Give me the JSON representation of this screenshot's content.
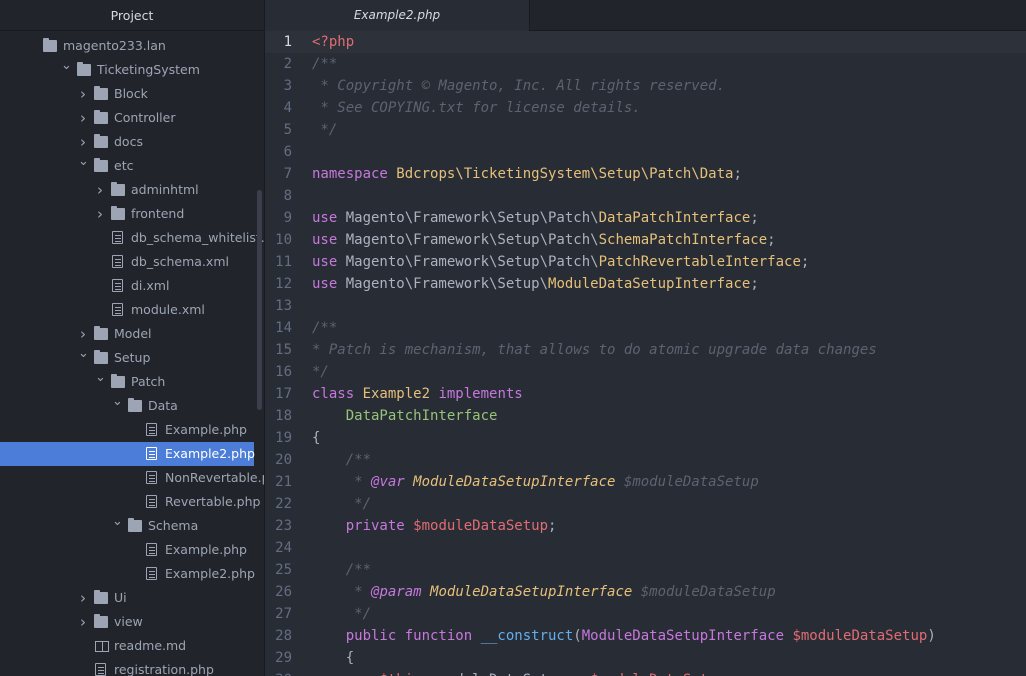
{
  "sidebar": {
    "header": "Project",
    "items": [
      {
        "label": "magento233.lan",
        "kind": "folder",
        "arrow": "",
        "indent": 0
      },
      {
        "label": "TicketingSystem",
        "kind": "folder",
        "arrow": "open",
        "indent": 2
      },
      {
        "label": "Block",
        "kind": "folder",
        "arrow": "closed",
        "indent": 3
      },
      {
        "label": "Controller",
        "kind": "folder",
        "arrow": "closed",
        "indent": 3
      },
      {
        "label": "docs",
        "kind": "folder",
        "arrow": "closed",
        "indent": 3
      },
      {
        "label": "etc",
        "kind": "folder",
        "arrow": "open",
        "indent": 3
      },
      {
        "label": "adminhtml",
        "kind": "folder",
        "arrow": "closed",
        "indent": 4
      },
      {
        "label": "frontend",
        "kind": "folder",
        "arrow": "closed",
        "indent": 4
      },
      {
        "label": "db_schema_whitelist.json",
        "kind": "file",
        "arrow": "",
        "indent": 4
      },
      {
        "label": "db_schema.xml",
        "kind": "file",
        "arrow": "",
        "indent": 4
      },
      {
        "label": "di.xml",
        "kind": "file",
        "arrow": "",
        "indent": 4
      },
      {
        "label": "module.xml",
        "kind": "file",
        "arrow": "",
        "indent": 4
      },
      {
        "label": "Model",
        "kind": "folder",
        "arrow": "closed",
        "indent": 3
      },
      {
        "label": "Setup",
        "kind": "folder",
        "arrow": "open",
        "indent": 3
      },
      {
        "label": "Patch",
        "kind": "folder",
        "arrow": "open",
        "indent": 4
      },
      {
        "label": "Data",
        "kind": "folder",
        "arrow": "open",
        "indent": 5
      },
      {
        "label": "Example.php",
        "kind": "file",
        "arrow": "",
        "indent": 6
      },
      {
        "label": "Example2.php",
        "kind": "file",
        "arrow": "",
        "indent": 6,
        "selected": true
      },
      {
        "label": "NonRevertable.php",
        "kind": "file",
        "arrow": "",
        "indent": 6
      },
      {
        "label": "Revertable.php",
        "kind": "file",
        "arrow": "",
        "indent": 6
      },
      {
        "label": "Schema",
        "kind": "folder",
        "arrow": "open",
        "indent": 5
      },
      {
        "label": "Example.php",
        "kind": "file",
        "arrow": "",
        "indent": 6
      },
      {
        "label": "Example2.php",
        "kind": "file",
        "arrow": "",
        "indent": 6
      },
      {
        "label": "Ui",
        "kind": "folder",
        "arrow": "closed",
        "indent": 3
      },
      {
        "label": "view",
        "kind": "folder",
        "arrow": "closed",
        "indent": 3
      },
      {
        "label": "readme.md",
        "kind": "book",
        "arrow": "",
        "indent": 3
      },
      {
        "label": "registration.php",
        "kind": "file",
        "arrow": "",
        "indent": 3
      }
    ]
  },
  "tabs": [
    {
      "label": "Example2.php",
      "active": true
    }
  ],
  "editor": {
    "current_line": 1,
    "lines": [
      {
        "n": "1",
        "tokens": [
          [
            "tag",
            "<?php"
          ]
        ]
      },
      {
        "n": "2",
        "tokens": [
          [
            "comment",
            "/**"
          ]
        ]
      },
      {
        "n": "3",
        "tokens": [
          [
            "comment",
            " * Copyright © Magento, Inc. All rights reserved."
          ]
        ]
      },
      {
        "n": "4",
        "tokens": [
          [
            "comment",
            " * See COPYING.txt for license details."
          ]
        ]
      },
      {
        "n": "5",
        "tokens": [
          [
            "comment",
            " */"
          ]
        ]
      },
      {
        "n": "6",
        "tokens": []
      },
      {
        "n": "7",
        "tokens": [
          [
            "kw",
            "namespace "
          ],
          [
            "class",
            "Bdcrops\\TicketingSystem\\Setup\\Patch\\Data"
          ],
          [
            "plain",
            ";"
          ]
        ]
      },
      {
        "n": "8",
        "tokens": []
      },
      {
        "n": "9",
        "tokens": [
          [
            "kw",
            "use "
          ],
          [
            "plain",
            "Magento\\Framework\\Setup\\Patch\\"
          ],
          [
            "class",
            "DataPatchInterface"
          ],
          [
            "plain",
            ";"
          ]
        ]
      },
      {
        "n": "10",
        "tokens": [
          [
            "kw",
            "use "
          ],
          [
            "plain",
            "Magento\\Framework\\Setup\\Patch\\"
          ],
          [
            "class",
            "SchemaPatchInterface"
          ],
          [
            "plain",
            ";"
          ]
        ]
      },
      {
        "n": "11",
        "tokens": [
          [
            "kw",
            "use "
          ],
          [
            "plain",
            "Magento\\Framework\\Setup\\Patch\\"
          ],
          [
            "class",
            "PatchRevertableInterface"
          ],
          [
            "plain",
            ";"
          ]
        ]
      },
      {
        "n": "12",
        "tokens": [
          [
            "kw",
            "use "
          ],
          [
            "plain",
            "Magento\\Framework\\Setup\\"
          ],
          [
            "class",
            "ModuleDataSetupInterface"
          ],
          [
            "plain",
            ";"
          ]
        ]
      },
      {
        "n": "13",
        "tokens": []
      },
      {
        "n": "14",
        "tokens": [
          [
            "comment",
            "/**"
          ]
        ]
      },
      {
        "n": "15",
        "tokens": [
          [
            "comment",
            "* Patch is mechanism, that allows to do atomic upgrade data changes"
          ]
        ]
      },
      {
        "n": "16",
        "tokens": [
          [
            "comment",
            "*/"
          ]
        ]
      },
      {
        "n": "17",
        "tokens": [
          [
            "kw",
            "class "
          ],
          [
            "class",
            "Example2"
          ],
          [
            "plain",
            " "
          ],
          [
            "kw",
            "implements"
          ]
        ]
      },
      {
        "n": "18",
        "tokens": [
          [
            "plain",
            "    "
          ],
          [
            "iface",
            "DataPatchInterface"
          ]
        ]
      },
      {
        "n": "19",
        "tokens": [
          [
            "plain",
            "{"
          ]
        ]
      },
      {
        "n": "20",
        "tokens": [
          [
            "plain",
            "    "
          ],
          [
            "comment",
            "/**"
          ]
        ]
      },
      {
        "n": "21",
        "tokens": [
          [
            "plain",
            "    "
          ],
          [
            "comment",
            " * "
          ],
          [
            "doctag",
            "@var"
          ],
          [
            "comment",
            " "
          ],
          [
            "doctype",
            "ModuleDataSetupInterface"
          ],
          [
            "comment",
            " $moduleDataSetup"
          ]
        ]
      },
      {
        "n": "22",
        "tokens": [
          [
            "plain",
            "    "
          ],
          [
            "comment",
            " */"
          ]
        ]
      },
      {
        "n": "23",
        "tokens": [
          [
            "plain",
            "    "
          ],
          [
            "kw",
            "private "
          ],
          [
            "var",
            "$moduleDataSetup"
          ],
          [
            "plain",
            ";"
          ]
        ]
      },
      {
        "n": "24",
        "tokens": []
      },
      {
        "n": "25",
        "tokens": [
          [
            "plain",
            "    "
          ],
          [
            "comment",
            "/**"
          ]
        ]
      },
      {
        "n": "26",
        "tokens": [
          [
            "plain",
            "    "
          ],
          [
            "comment",
            " * "
          ],
          [
            "doctag",
            "@param"
          ],
          [
            "comment",
            " "
          ],
          [
            "doctype",
            "ModuleDataSetupInterface"
          ],
          [
            "comment",
            " $moduleDataSetup"
          ]
        ]
      },
      {
        "n": "27",
        "tokens": [
          [
            "plain",
            "    "
          ],
          [
            "comment",
            " */"
          ]
        ]
      },
      {
        "n": "28",
        "tokens": [
          [
            "plain",
            "    "
          ],
          [
            "kw",
            "public function "
          ],
          [
            "fn",
            "__construct"
          ],
          [
            "plain",
            "("
          ],
          [
            "kw",
            "ModuleDataSetupInterface "
          ],
          [
            "var",
            "$moduleDataSetup"
          ],
          [
            "plain",
            ")"
          ]
        ]
      },
      {
        "n": "29",
        "tokens": [
          [
            "plain",
            "    {"
          ]
        ]
      },
      {
        "n": "30",
        "tokens": [
          [
            "plain",
            "        "
          ],
          [
            "var",
            "$this"
          ],
          [
            "plain",
            "->moduleDataSetup = "
          ],
          [
            "var",
            "$moduleDataSetup"
          ],
          [
            "plain",
            ";"
          ]
        ]
      }
    ]
  }
}
